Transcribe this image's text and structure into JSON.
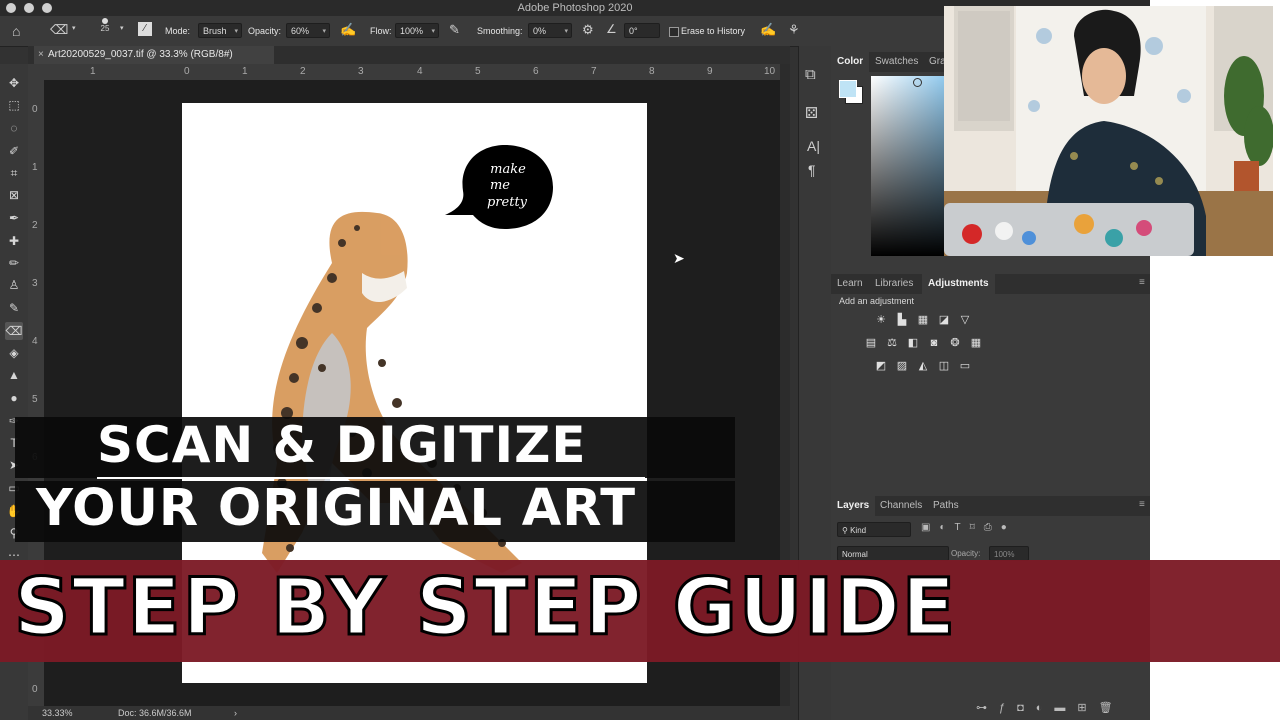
{
  "app_title": "Adobe Photoshop 2020",
  "options_bar": {
    "brush_size": "25",
    "mode_label": "Mode:",
    "mode_value": "Brush",
    "opacity_label": "Opacity:",
    "opacity_value": "60%",
    "flow_label": "Flow:",
    "flow_value": "100%",
    "smoothing_label": "Smoothing:",
    "smoothing_value": "0%",
    "angle_value": "0°",
    "erase_to_history": "Erase to History"
  },
  "document": {
    "tab_title": "Art20200529_0037.tif @ 33.3% (RGB/8#)",
    "close_glyph": "×"
  },
  "rulers": {
    "horizontal": [
      "1",
      "0",
      "1",
      "2",
      "3",
      "4",
      "5",
      "6",
      "7",
      "8",
      "9",
      "10"
    ],
    "vertical": [
      "0",
      "1",
      "2",
      "3",
      "4",
      "5",
      "6",
      "0"
    ]
  },
  "status": {
    "zoom": "33.33%",
    "doc": "Doc: 36.6M/36.6M",
    "arrow": "›"
  },
  "speech_bubble": {
    "line1": "make",
    "line2": "me",
    "line3": "pretty"
  },
  "color_panel": {
    "tabs": [
      "Color",
      "Swatches",
      "Gra"
    ],
    "foreground": "#bfe3f5",
    "background": "#ffffff",
    "hue": "#8fc9ee"
  },
  "adjustments_panel": {
    "tabs": [
      "Learn",
      "Libraries",
      "Adjustments"
    ],
    "heading": "Add an adjustment",
    "icon_rows": [
      [
        "brightness-icon",
        "levels-icon",
        "curves-icon",
        "exposure-icon",
        "vibrance-icon"
      ],
      [
        "hue-saturation-icon",
        "color-balance-icon",
        "black-white-icon",
        "photo-filter-icon",
        "channel-mixer-icon",
        "color-lookup-icon"
      ],
      [
        "invert-icon",
        "posterize-icon",
        "threshold-icon",
        "selective-color-icon",
        "gradient-map-icon"
      ]
    ]
  },
  "layers_panel": {
    "tabs": [
      "Layers",
      "Channels",
      "Paths"
    ],
    "kind_label": "Kind",
    "blend_mode": "Normal",
    "opacity_label": "Opacity:",
    "opacity_value": "100%"
  },
  "overlay": {
    "line1": "SCAN & DIGITIZE",
    "line2": "YOUR ORIGINAL ART",
    "line3": "STEP BY STEP GUIDE",
    "band_color": "#7c1a25"
  }
}
